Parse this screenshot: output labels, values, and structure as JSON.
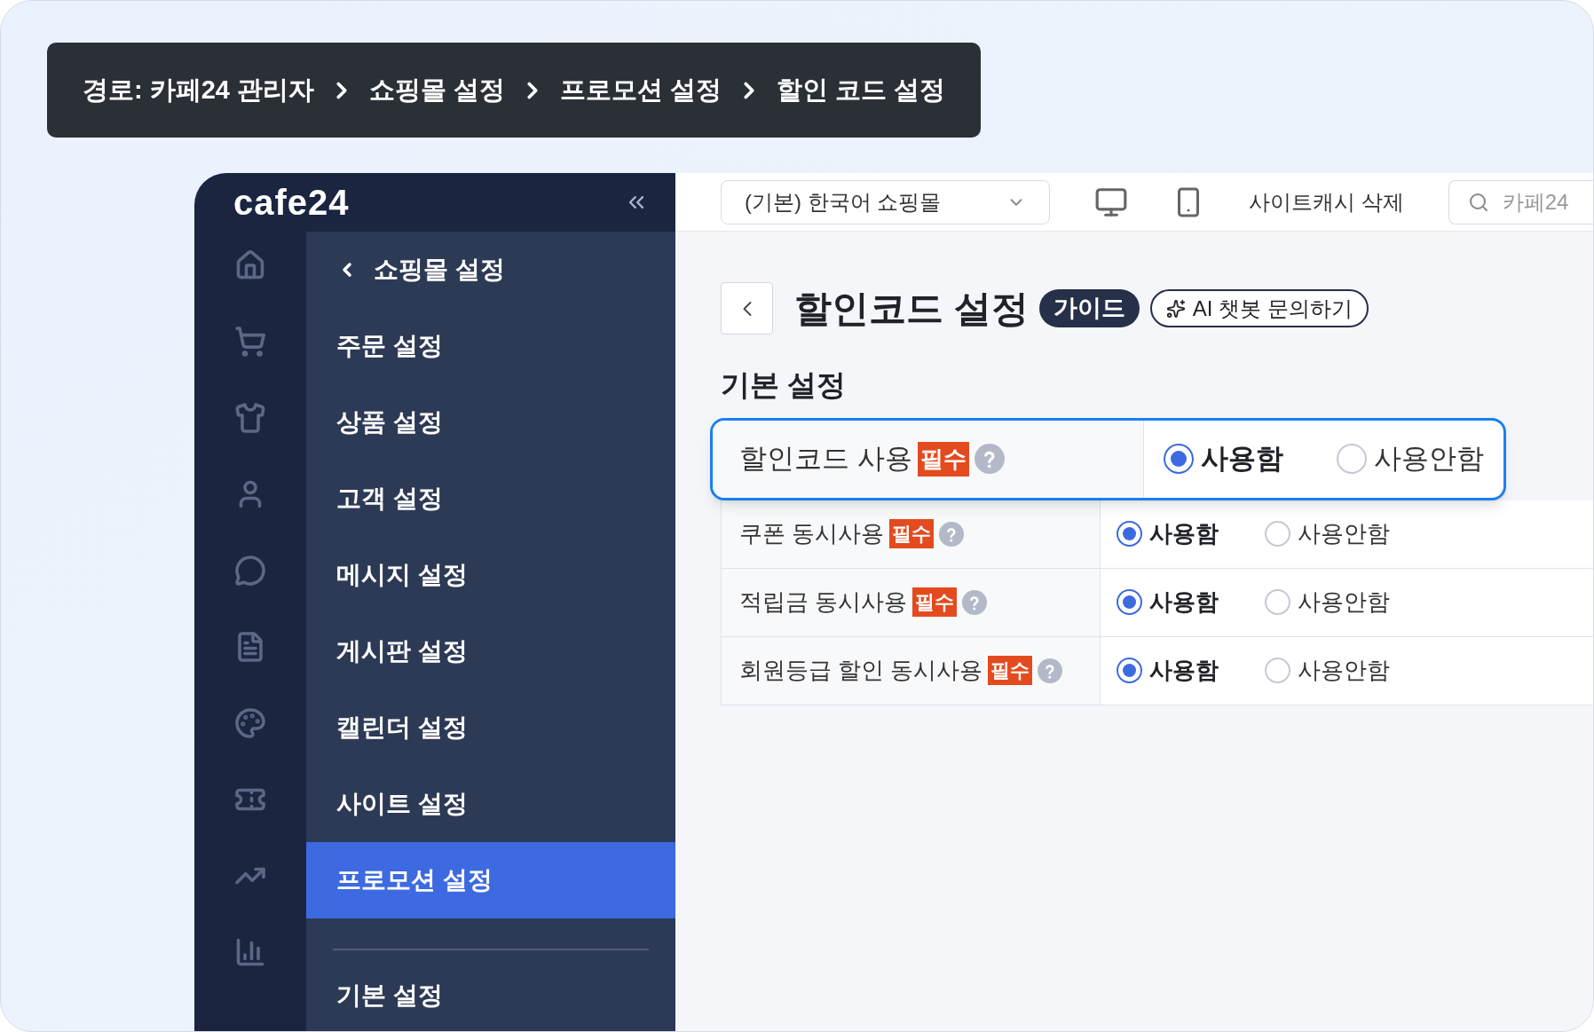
{
  "breadcrumb": [
    "경로: 카페24 관리자",
    "쇼핑몰 설정",
    "프로모션 설정",
    "할인 코드 설정"
  ],
  "logo": "cafe24",
  "menu": {
    "back_item": "쇼핑몰 설정",
    "items": [
      {
        "label": "주문 설정",
        "selected": false
      },
      {
        "label": "상품 설정",
        "selected": false
      },
      {
        "label": "고객 설정",
        "selected": false
      },
      {
        "label": "메시지 설정",
        "selected": false
      },
      {
        "label": "게시판 설정",
        "selected": false
      },
      {
        "label": "캘린더 설정",
        "selected": false
      },
      {
        "label": "사이트 설정",
        "selected": false
      },
      {
        "label": "프로모션 설정",
        "selected": true
      }
    ],
    "next_group": "기본 설정"
  },
  "topbar": {
    "shop_select": "(기본) 한국어 쇼핑몰",
    "cache_button": "사이트캐시 삭제",
    "search": {
      "placeholder": "카페24"
    }
  },
  "page": {
    "title": "할인코드 설정",
    "guide_badge": "가이드",
    "ai_button": "AI 챗봇 문의하기"
  },
  "section_title": "기본 설정",
  "rows": [
    {
      "label": "할인코드 사용",
      "required": "필수",
      "highlighted": true,
      "options": [
        {
          "label": "사용함",
          "selected": true
        },
        {
          "label": "사용안함",
          "selected": false
        }
      ]
    },
    {
      "label": "쿠폰 동시사용",
      "required": "필수",
      "highlighted": false,
      "options": [
        {
          "label": "사용함",
          "selected": true
        },
        {
          "label": "사용안함",
          "selected": false
        }
      ]
    },
    {
      "label": "적립금 동시사용",
      "required": "필수",
      "highlighted": false,
      "options": [
        {
          "label": "사용함",
          "selected": true
        },
        {
          "label": "사용안함",
          "selected": false
        }
      ]
    },
    {
      "label": "회원등급 할인 동시사용",
      "required": "필수",
      "highlighted": false,
      "options": [
        {
          "label": "사용함",
          "selected": true
        },
        {
          "label": "사용안함",
          "selected": false
        }
      ]
    }
  ]
}
